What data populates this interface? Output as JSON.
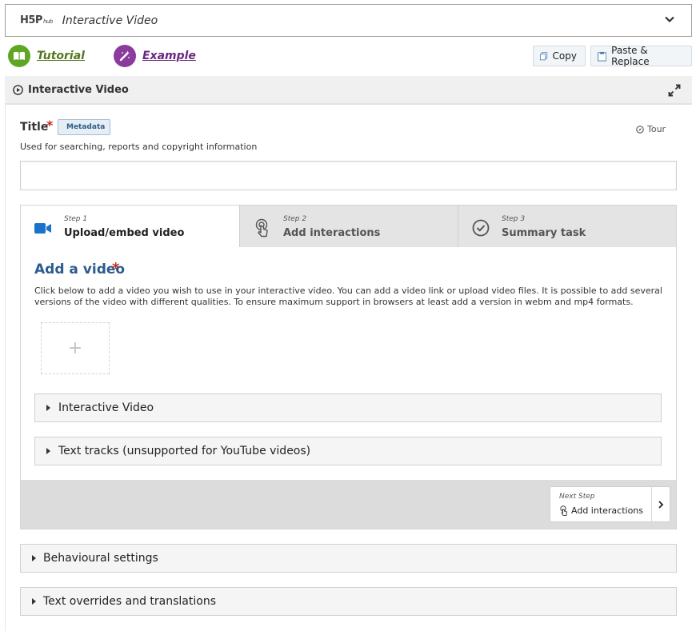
{
  "hub": {
    "logo_main": "H5P",
    "logo_sub": "hub",
    "content_type": "Interactive Video"
  },
  "links": {
    "tutorial": "Tutorial",
    "example": "Example"
  },
  "actions": {
    "copy": "Copy",
    "paste_replace": "Paste & Replace"
  },
  "section": {
    "title": "Interactive Video"
  },
  "title_field": {
    "label": "Title",
    "required_mark": "*",
    "metadata": "Metadata",
    "tour": "Tour",
    "description": "Used for searching, reports and copyright information",
    "value": ""
  },
  "wizard": {
    "steps": [
      {
        "number": "Step 1",
        "label": "Upload/embed video",
        "icon": "video-camera-icon",
        "active": true
      },
      {
        "number": "Step 2",
        "label": "Add interactions",
        "icon": "touch-hand-icon",
        "active": false
      },
      {
        "number": "Step 3",
        "label": "Summary task",
        "icon": "check-circle-icon",
        "active": false
      }
    ],
    "add_video": {
      "heading": "Add a video",
      "required_mark": "*",
      "description": "Click below to add a video you wish to use in your interactive video. You can add a video link or upload video files. It is possible to add several versions of the video with different qualities. To ensure maximum support in browsers at least add a version in webm and mp4 formats.",
      "add_symbol": "+"
    },
    "collapsibles": [
      {
        "label": "Interactive Video"
      },
      {
        "label": "Text tracks (unsupported for YouTube videos)"
      }
    ],
    "next": {
      "caption": "Next Step",
      "label": "Add interactions"
    }
  },
  "groups": [
    {
      "label": "Behavioural settings"
    },
    {
      "label": "Text overrides and translations"
    }
  ],
  "colors": {
    "required": "#c82a1c",
    "heading_blue": "#2d5c8f",
    "tutorial_green": "#5fa624",
    "example_purple": "#8b3a9e",
    "video_icon_blue": "#1a73c8"
  }
}
